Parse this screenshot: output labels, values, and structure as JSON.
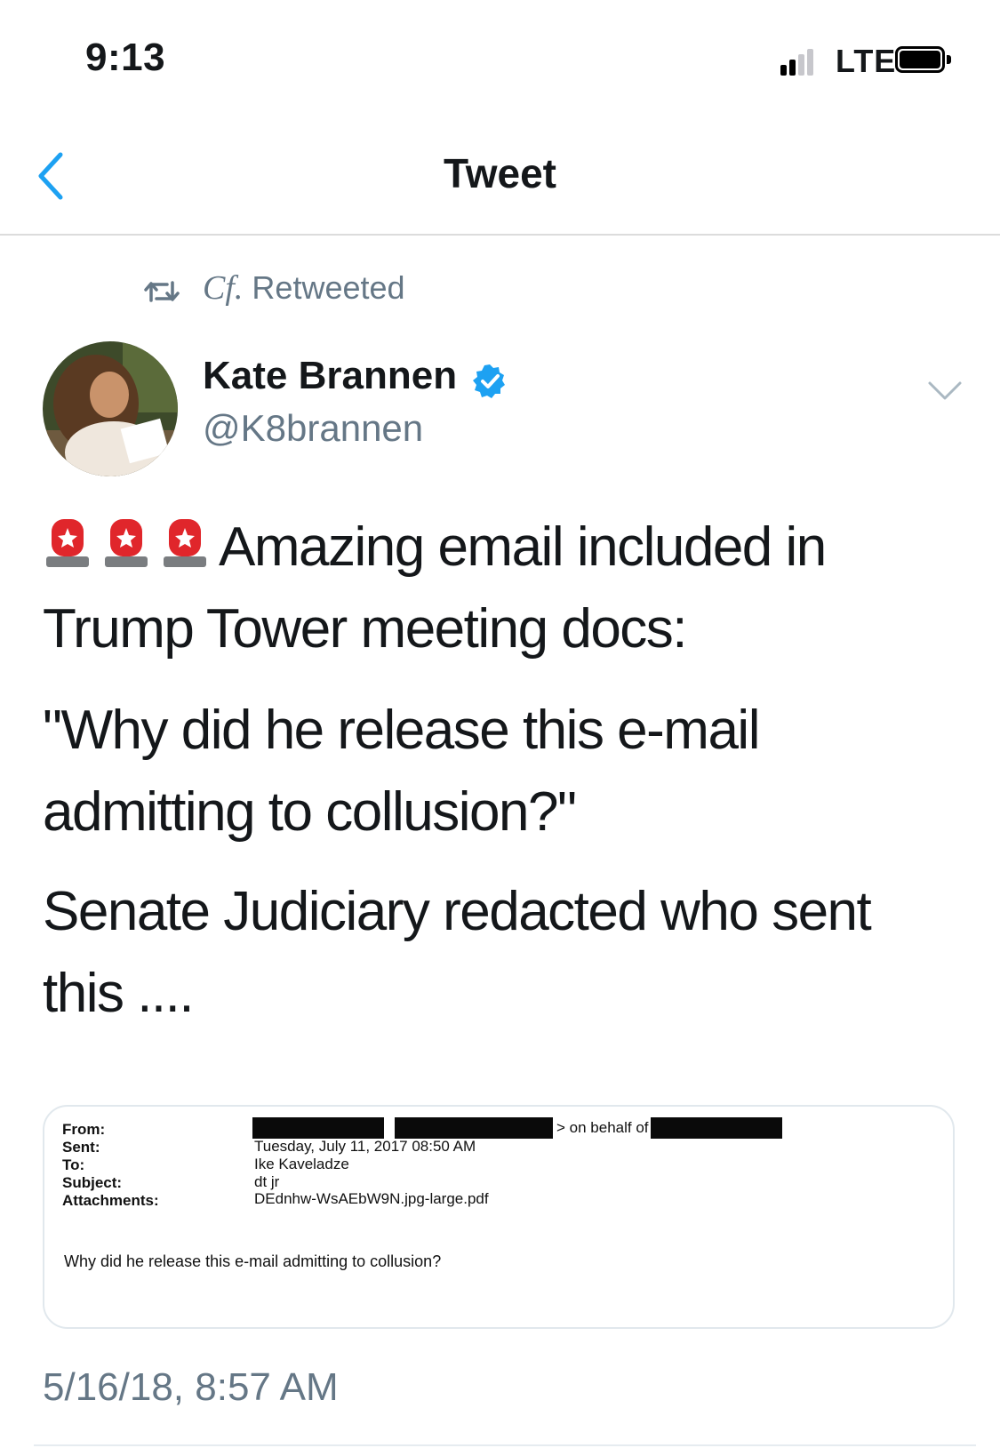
{
  "status_bar": {
    "time": "9:13",
    "network": "LTE"
  },
  "nav": {
    "title": "Tweet"
  },
  "retweet": {
    "by": "Cf.",
    "label": "Retweeted"
  },
  "author": {
    "name": "Kate Brannen",
    "handle": "@K8brannen",
    "verified": true
  },
  "tweet": {
    "line1": "Amazing email included in",
    "line2": "Trump Tower meeting docs:",
    "line3": "\"Why did he release this e-mail",
    "line4": "admitting to collusion?\"",
    "line5": "Senate Judiciary redacted who sent",
    "line6": "this ....",
    "emoji": "police-car-light",
    "emoji_count": 3
  },
  "email_image": {
    "labels": {
      "from": "From:",
      "sent": "Sent:",
      "to": "To:",
      "subject": "Subject:",
      "attachments": "Attachments:"
    },
    "from_suffix": "on behalf of",
    "sent": "Tuesday, July 11, 2017 08:50 AM",
    "to": "Ike Kaveladze",
    "subject": "dt jr",
    "attachments": "DEdnhw-WsAEbW9N.jpg-large.pdf",
    "body": "Why did he release this e-mail admitting to collusion?"
  },
  "timestamp": "5/16/18, 8:57 AM",
  "colors": {
    "accent": "#1da1f2",
    "secondary_text": "#657786",
    "text": "#14171a"
  }
}
